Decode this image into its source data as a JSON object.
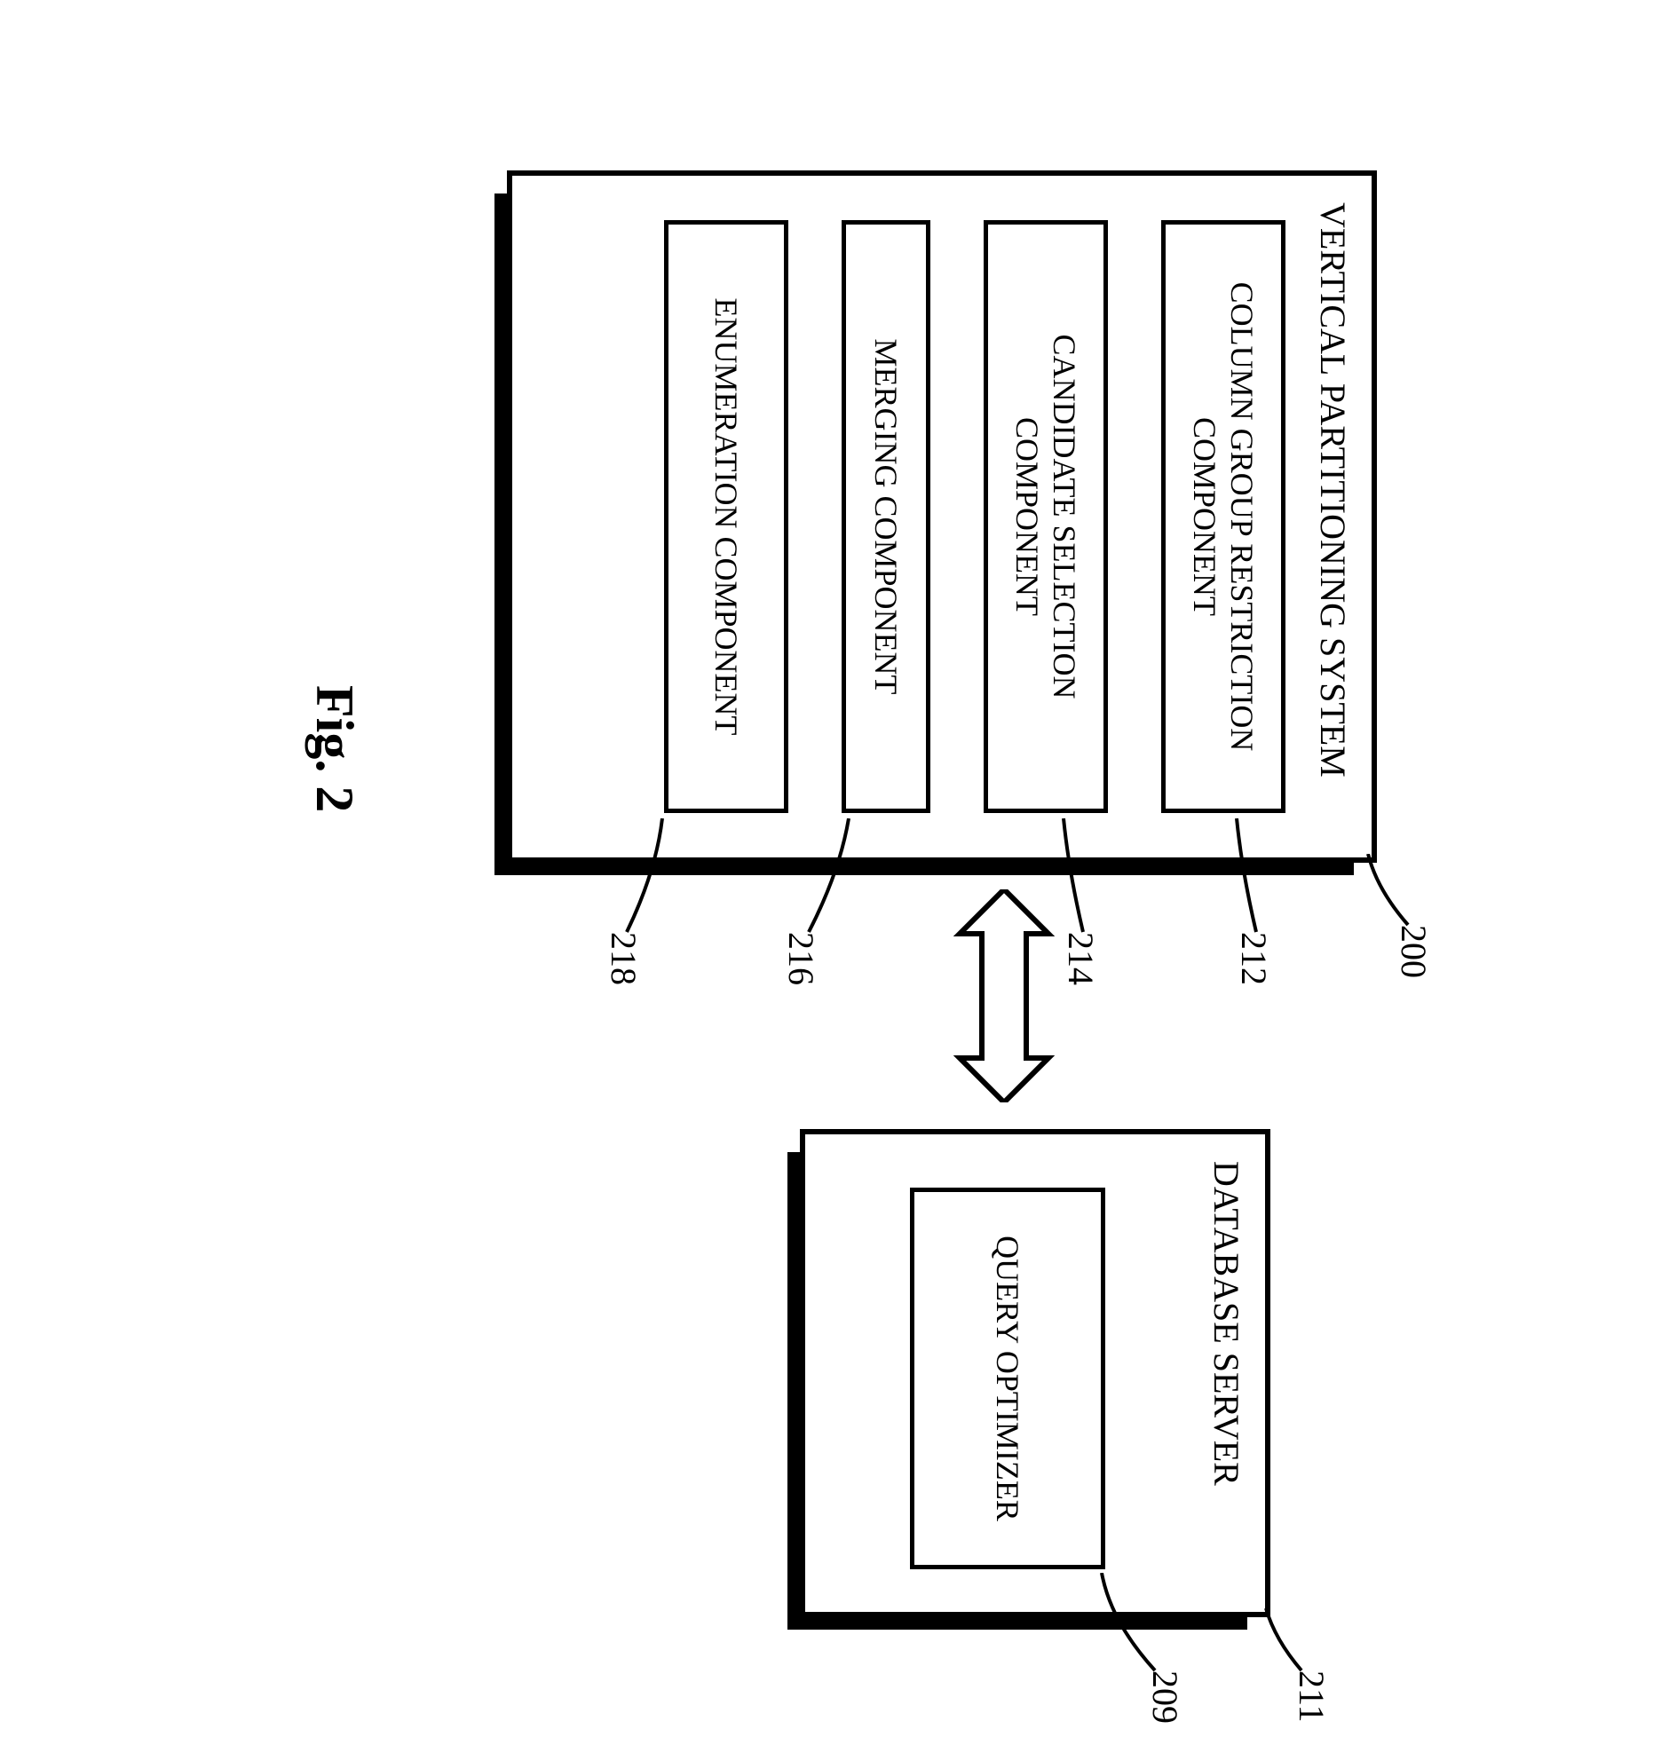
{
  "figure_label": "Fig. 2",
  "vp_system": {
    "title": "VERTICAL PARTITIONING SYSTEM",
    "ref": "200",
    "components": [
      {
        "label": "COLUMN GROUP RESTRICTION COMPONENT",
        "ref": "212"
      },
      {
        "label": "CANDIDATE SELECTION COMPONENT",
        "ref": "214"
      },
      {
        "label": "MERGING COMPONENT",
        "ref": "216"
      },
      {
        "label": "ENUMERATION COMPONENT",
        "ref": "218"
      }
    ]
  },
  "db_server": {
    "title": "DATABASE SERVER",
    "ref": "211",
    "query_optimizer": {
      "label": "QUERY OPTIMIZER",
      "ref": "209"
    }
  }
}
